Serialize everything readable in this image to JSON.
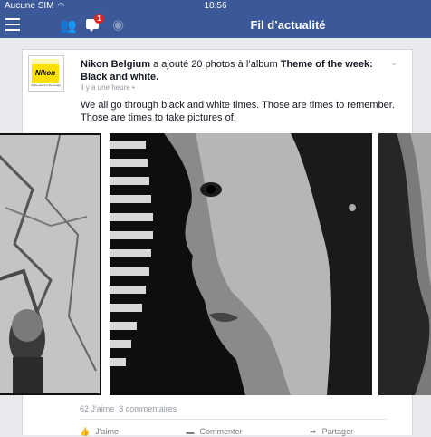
{
  "status": {
    "carrier": "Aucune SIM",
    "time": "18:56"
  },
  "nav": {
    "title": "Fil d’actualité",
    "badge": "1"
  },
  "post": {
    "logo_brand": "Nikon",
    "logo_tagline": "At the heart of the image",
    "author": "Nikon Belgium",
    "action": " a ajouté 20 photos à l’album ",
    "album": "Theme of the week: Black and white.",
    "time": "il y a une heure",
    "message": "We all go through black and white times. Those are times to remember. Those are times to take pictures of.",
    "likes": "62 J'aime",
    "comments": "3 commentaires",
    "actions": {
      "like": "J'aime",
      "comment": "Commenter",
      "share": "Partager"
    }
  },
  "icons": [
    "menu-icon",
    "friends-icon",
    "messages-icon",
    "globe-icon",
    "chevron-down-icon",
    "globe-small-icon",
    "like-icon",
    "comment-icon",
    "share-icon"
  ]
}
